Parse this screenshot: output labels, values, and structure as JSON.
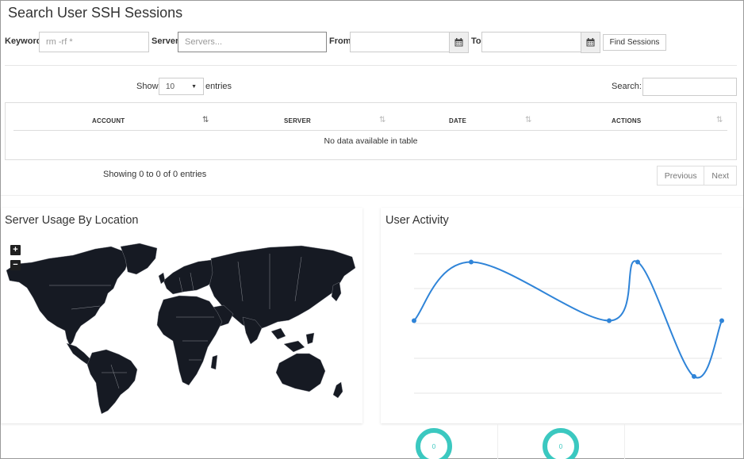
{
  "page": {
    "title": "Search User SSH Sessions"
  },
  "filters": {
    "keyword_label": "Keyword",
    "keyword_placeholder": "rm -rf *",
    "server_label": "Server",
    "server_placeholder": "Servers...",
    "from_label": "From",
    "to_label": "To",
    "find_button": "Find Sessions"
  },
  "table": {
    "show_label": "Show",
    "page_size": "10",
    "entries_label": "entries",
    "search_label": "Search:",
    "columns": [
      "ACCOUNT",
      "SERVER",
      "DATE",
      "ACTIONS"
    ],
    "empty_message": "No data available in table",
    "info": "Showing 0 to 0 of 0 entries",
    "prev_label": "Previous",
    "next_label": "Next"
  },
  "server_usage": {
    "title": "Server Usage By Location",
    "zoom_in": "+",
    "zoom_out": "−"
  },
  "user_activity": {
    "title": "User Activity",
    "line_color": "#2f84d8",
    "gauges": [
      "0",
      "0"
    ]
  },
  "chart_data": {
    "type": "line",
    "series": [
      {
        "values": [
          2.6,
          4.7,
          2.6,
          4.7,
          0.6,
          2.6
        ]
      }
    ],
    "ylim": [
      0,
      5
    ],
    "grid": true
  }
}
